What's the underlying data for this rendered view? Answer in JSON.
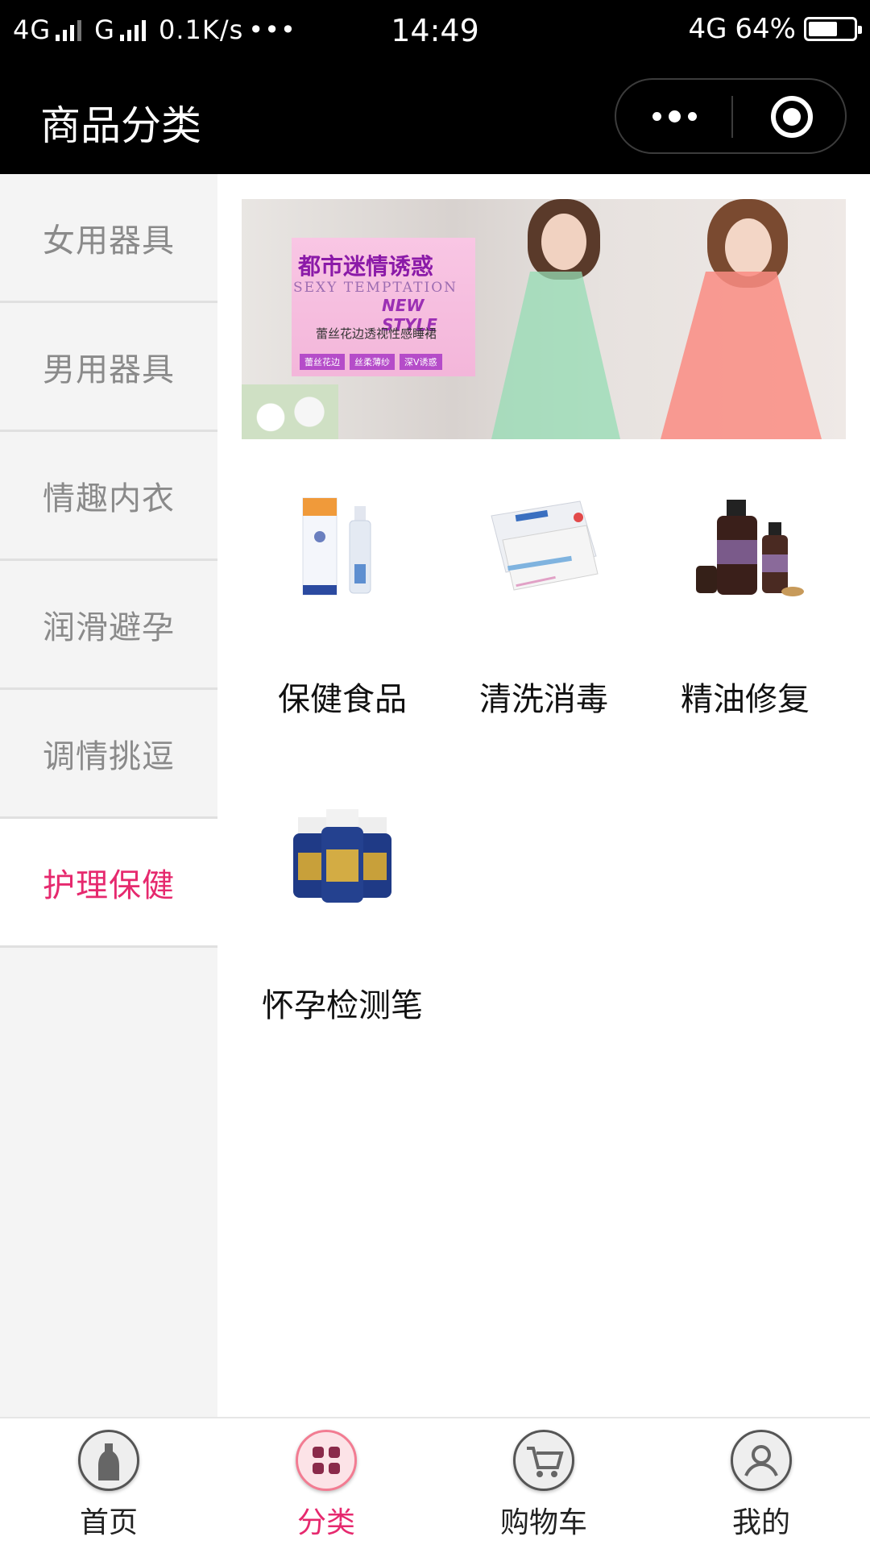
{
  "status_bar": {
    "network1": "4G",
    "network2": "G",
    "speed": "0.1K/s",
    "dots": "•••",
    "time": "14:49",
    "network_right": "4G",
    "battery": "64%",
    "battery_level": 0.64
  },
  "nav": {
    "title": "商品分类"
  },
  "sidebar": {
    "items": [
      {
        "label": "女用器具"
      },
      {
        "label": "男用器具"
      },
      {
        "label": "情趣内衣"
      },
      {
        "label": "润滑避孕"
      },
      {
        "label": "调情挑逗"
      },
      {
        "label": "护理保健"
      }
    ],
    "active_index": 5
  },
  "banner": {
    "title": "都市迷情诱惑",
    "en1": "SEXY TEMPTATION",
    "en2": "NEW STYLE",
    "subtitle": "蕾丝花边透视性感睡裙",
    "tags": [
      "蕾丝花边",
      "丝柔薄纱",
      "深V诱惑"
    ]
  },
  "products": [
    {
      "label": "保健食品",
      "icon": "spray-bottle-icon"
    },
    {
      "label": "清洗消毒",
      "icon": "test-kit-icon"
    },
    {
      "label": "精油修复",
      "icon": "essential-oil-icon"
    },
    {
      "label": "怀孕检测笔",
      "icon": "supplement-bottles-icon"
    }
  ],
  "tabbar": {
    "items": [
      {
        "label": "首页",
        "icon": "home-bottle-icon"
      },
      {
        "label": "分类",
        "icon": "category-grid-icon"
      },
      {
        "label": "购物车",
        "icon": "cart-icon"
      },
      {
        "label": "我的",
        "icon": "user-icon"
      }
    ],
    "active_index": 1
  },
  "colors": {
    "accent": "#e6296e",
    "nav_bg": "#000000",
    "sidebar_bg": "#f4f4f4"
  }
}
